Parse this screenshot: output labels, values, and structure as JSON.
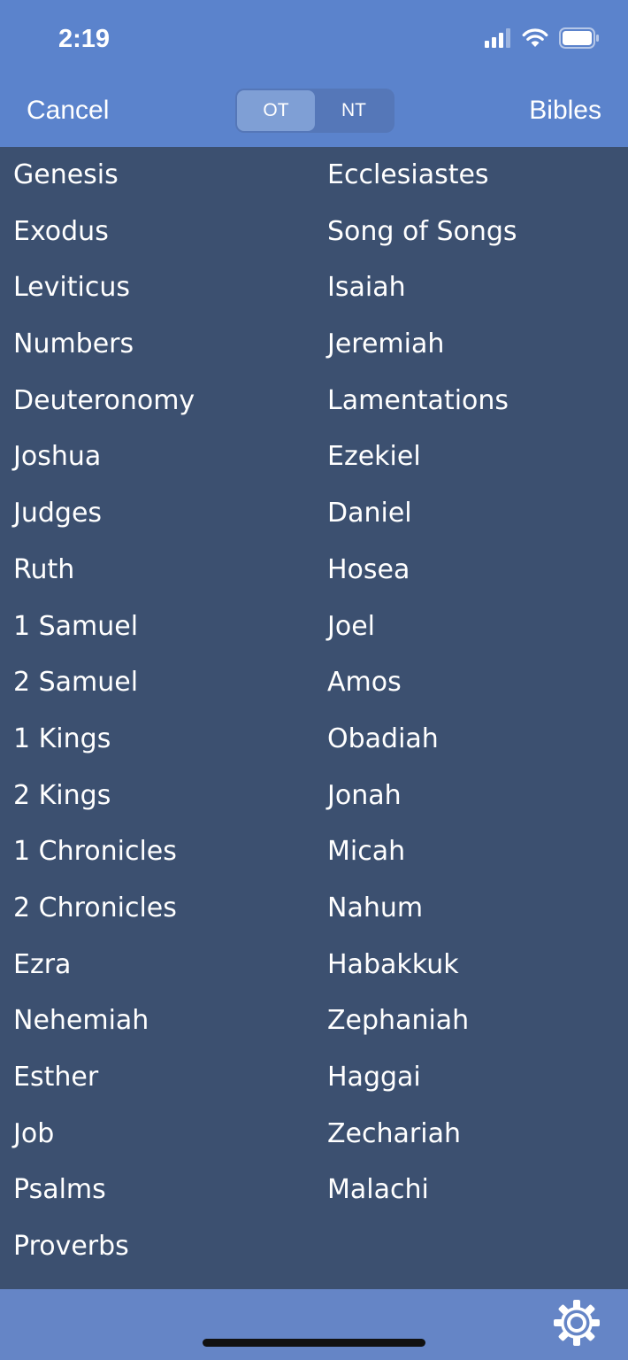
{
  "status_bar": {
    "time": "2:19",
    "icons": [
      "cellular-signal-icon",
      "wifi-icon",
      "battery-icon"
    ]
  },
  "nav": {
    "cancel_label": "Cancel",
    "bibles_label": "Bibles",
    "segments": [
      {
        "label": "OT",
        "selected": true
      },
      {
        "label": "NT",
        "selected": false
      }
    ]
  },
  "books": {
    "left_column": [
      "Genesis",
      "Exodus",
      "Leviticus",
      "Numbers",
      "Deuteronomy",
      "Joshua",
      "Judges",
      "Ruth",
      "1 Samuel",
      "2 Samuel",
      "1 Kings",
      "2 Kings",
      "1 Chronicles",
      "2 Chronicles",
      "Ezra",
      "Nehemiah",
      "Esther",
      "Job",
      "Psalms",
      "Proverbs"
    ],
    "right_column": [
      "Ecclesiastes",
      "Song of Songs",
      "Isaiah",
      "Jeremiah",
      "Lamentations",
      "Ezekiel",
      "Daniel",
      "Hosea",
      "Joel",
      "Amos",
      "Obadiah",
      "Jonah",
      "Micah",
      "Nahum",
      "Habakkuk",
      "Zephaniah",
      "Haggai",
      "Zechariah",
      "Malachi"
    ]
  },
  "bottom_bar": {
    "settings_icon": "gear-icon"
  },
  "colors": {
    "header_background": "#5b83cc",
    "list_background": "#3c5070",
    "bottom_bar_background": "#6585c6",
    "segment_active": "#7f9fd5",
    "text": "#ffffff"
  }
}
